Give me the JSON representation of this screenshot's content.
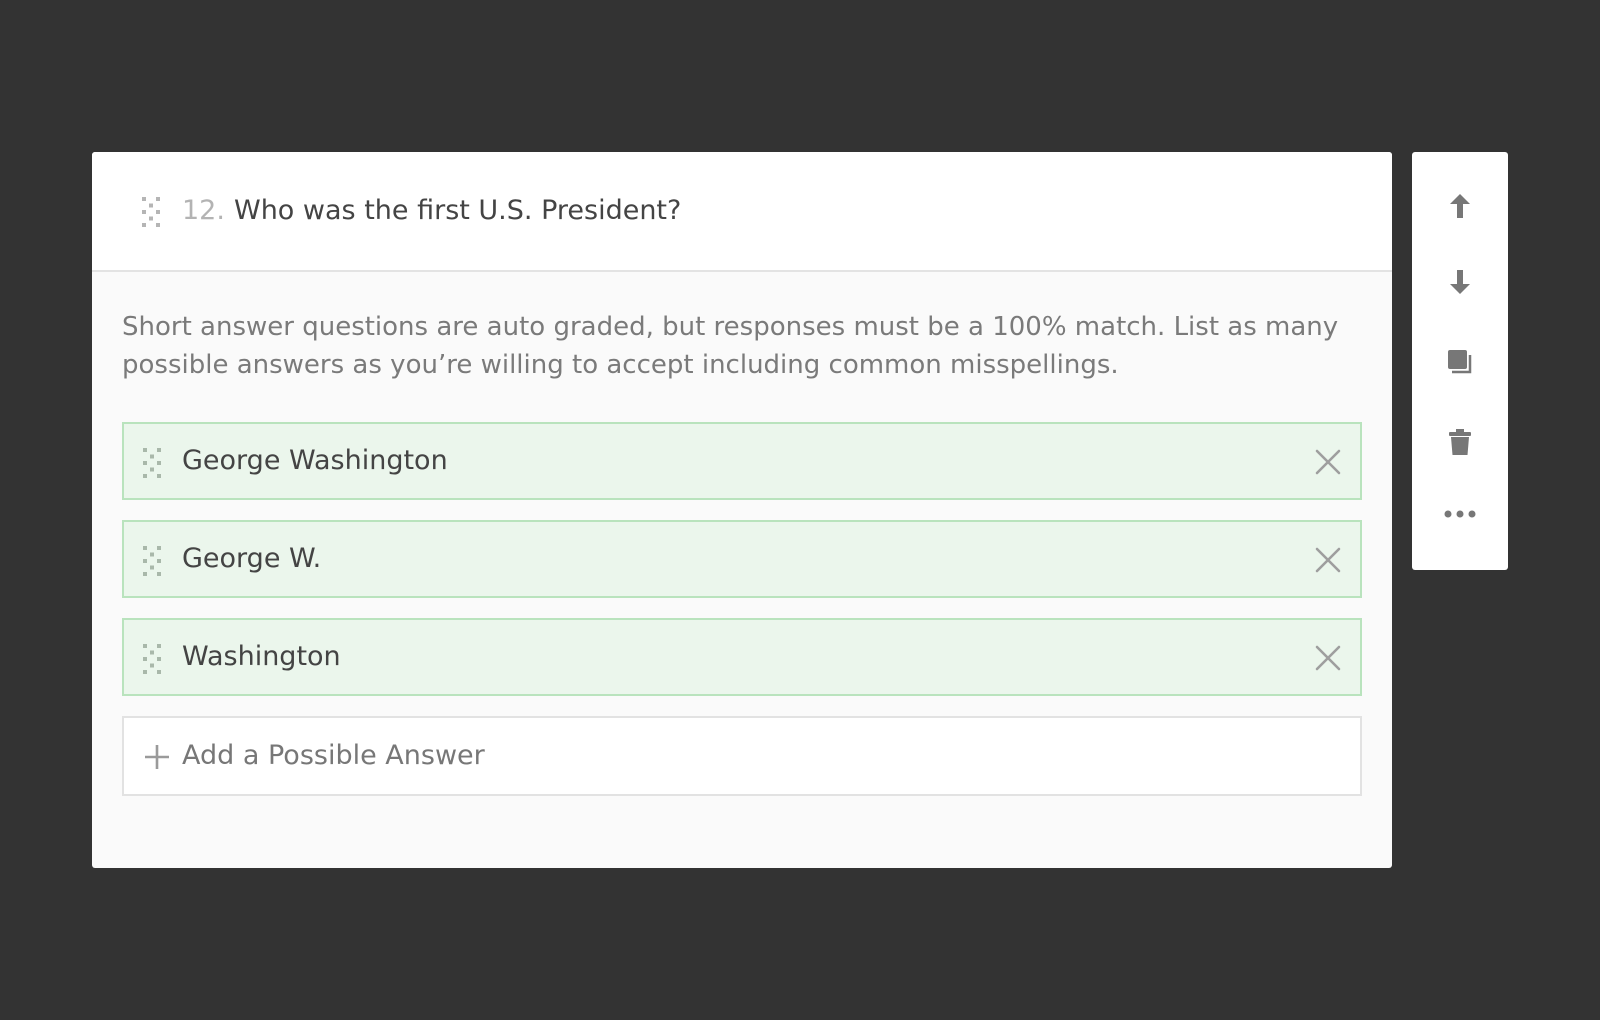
{
  "question": {
    "number": "12.",
    "title": "Who was the first U.S. President?",
    "instructions": "Short answer questions are auto graded, but responses must be a 100% match. List as many possible answers as you’re willing to accept including common misspellings."
  },
  "answers": [
    {
      "text": "George Washington"
    },
    {
      "text": "George W."
    },
    {
      "text": "Washington"
    }
  ],
  "add_answer": {
    "label": "Add a Possible Answer"
  },
  "toolbar": {
    "icons": [
      "arrow-up-icon",
      "arrow-down-icon",
      "duplicate-icon",
      "trash-icon",
      "more-icon"
    ]
  },
  "colors": {
    "background": "#333333",
    "answer_fill": "#ebf6ec",
    "answer_border": "#b9e3bd",
    "icon_gray": "#7a7a7a"
  }
}
